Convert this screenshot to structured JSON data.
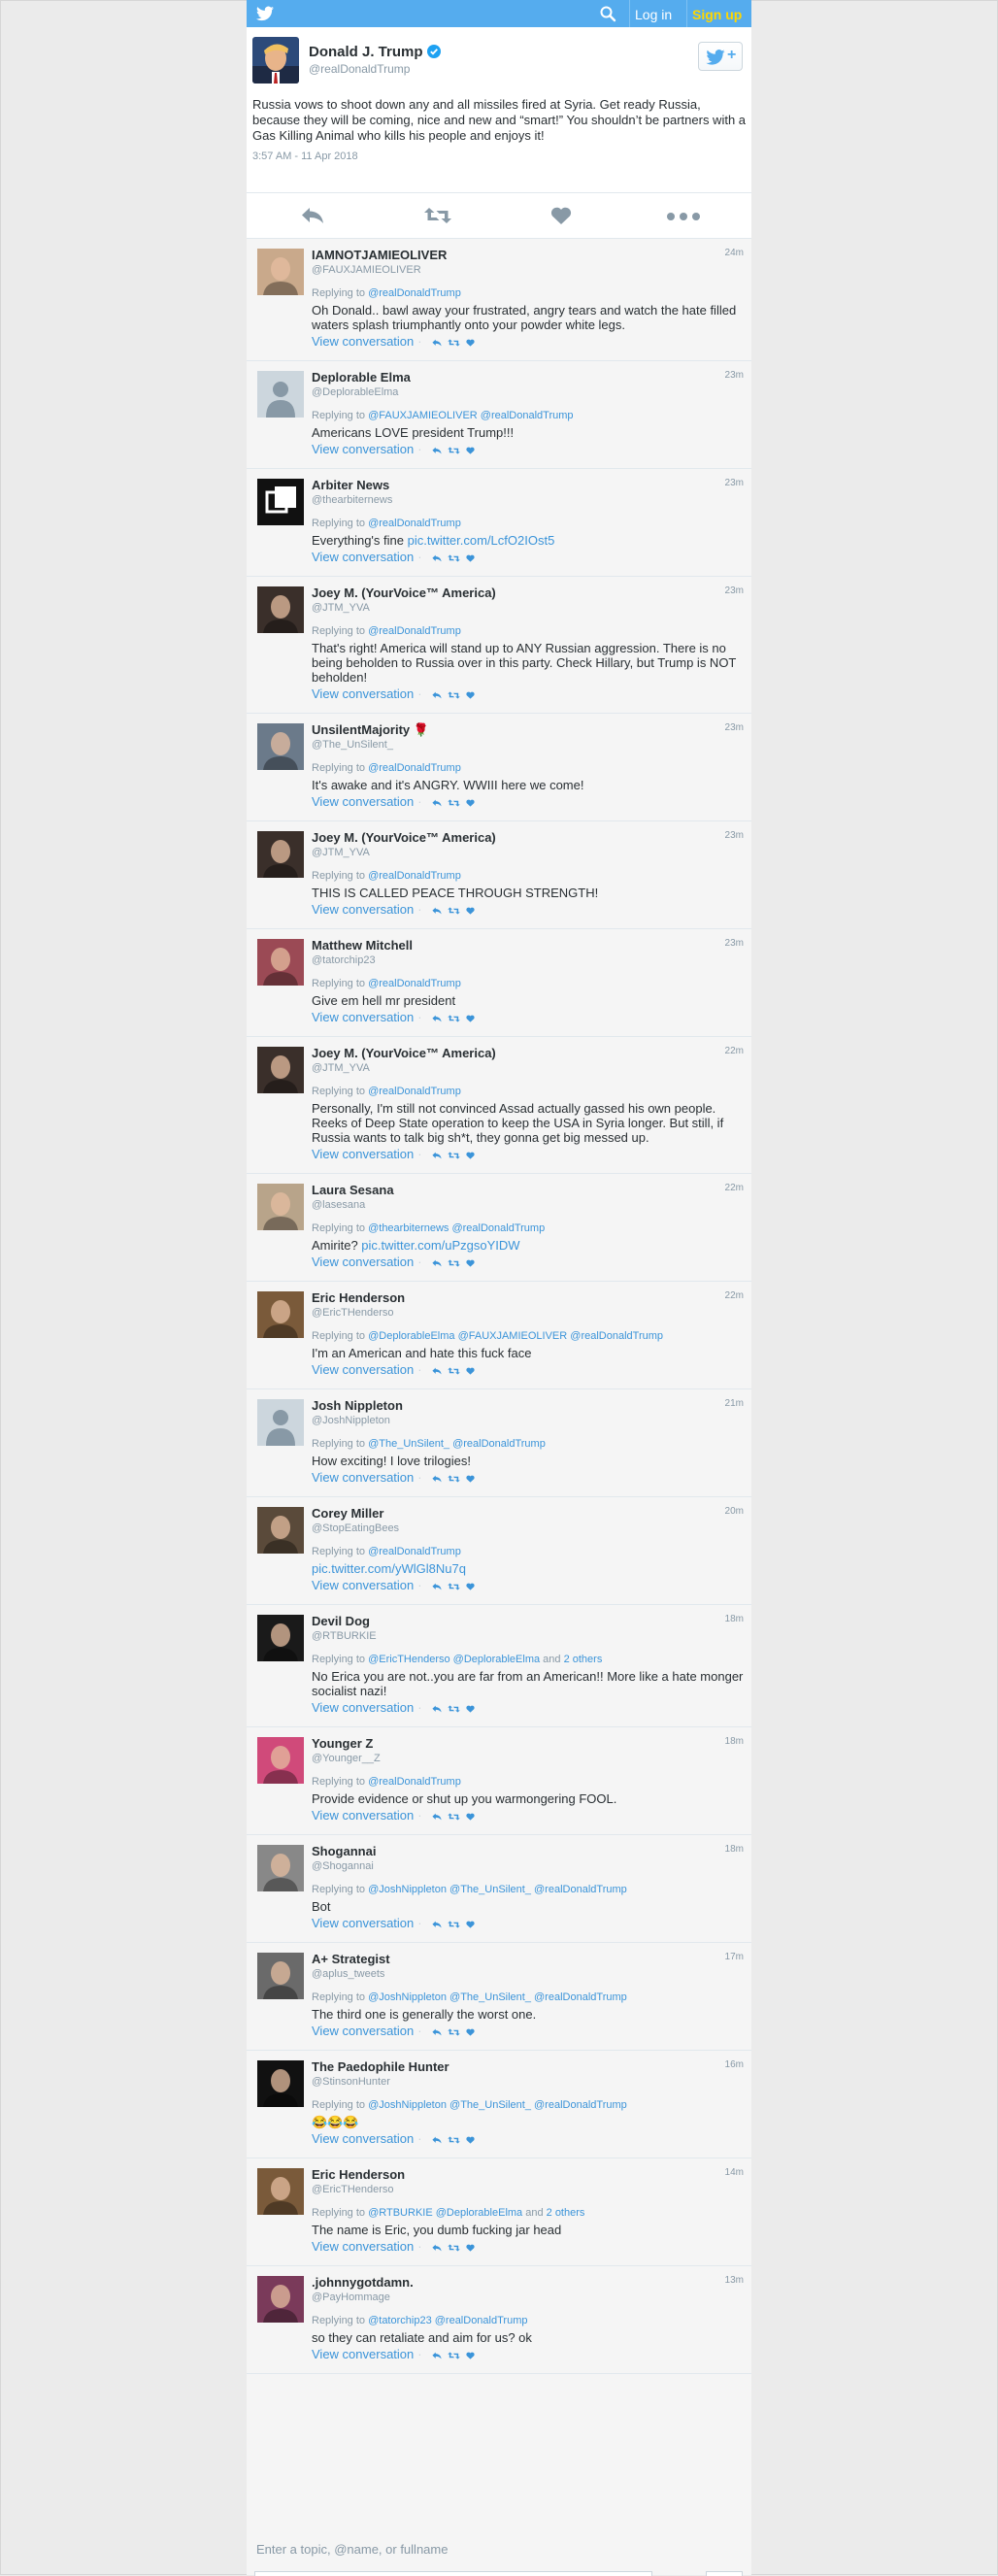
{
  "topbar": {
    "login": "Log in",
    "signup": "Sign up",
    "brand_color": "#55acee",
    "signup_color": "#ffd700"
  },
  "main_tweet": {
    "name": "Donald J. Trump",
    "handle": "@realDonaldTrump",
    "text": "Russia vows to shoot down any and all missiles fired at Syria. Get ready Russia, because they will be coming, nice and new and “smart!” You shouldn’t be partners with a Gas Killing Animal who kills his people and enjoys it!",
    "timestamp": "3:57 AM - 11 Apr 2018",
    "follow_label": "+"
  },
  "replies": [
    {
      "name": "IAMNOTJAMIEOLIVER",
      "handle": "@FAUXJAMIEOLIVER",
      "time": "24m",
      "replying_prefix": "Replying to ",
      "mentions": "@realDonaldTrump",
      "others": "",
      "text": "Oh Donald.. bawl away your frustrated, angry tears and watch the hate filled waters splash triumphantly onto your powder white legs.",
      "link": "",
      "avatar_color": "#c9a98b"
    },
    {
      "name": "Deplorable Elma",
      "handle": "@DeplorableElma",
      "time": "23m",
      "replying_prefix": "Replying to ",
      "mentions": "@FAUXJAMIEOLIVER @realDonaldTrump",
      "others": "",
      "text": "Americans LOVE president Trump!!!",
      "link": "",
      "avatar_color": "#ccd6dd"
    },
    {
      "name": "Arbiter News",
      "handle": "@thearbiternews",
      "time": "23m",
      "replying_prefix": "Replying to ",
      "mentions": "@realDonaldTrump",
      "others": "",
      "text": "Everything's fine ",
      "link": "pic.twitter.com/LcfO2IOst5",
      "avatar_color": "#111111"
    },
    {
      "name": "Joey M. (YourVoice™ America)",
      "handle": "@JTM_YVA",
      "time": "23m",
      "replying_prefix": "Replying to ",
      "mentions": "@realDonaldTrump",
      "others": "",
      "text": "That's right! America will stand up to ANY Russian aggression. There is no being beholden to Russia over in this party. Check Hillary, but Trump is NOT beholden!",
      "link": "",
      "avatar_color": "#3a2f2a"
    },
    {
      "name": "UnsilentMajority 🌹",
      "handle": "@The_UnSilent_",
      "time": "23m",
      "replying_prefix": "Replying to ",
      "mentions": "@realDonaldTrump",
      "others": "",
      "text": "It's awake and it's ANGRY. WWIII here we come!",
      "link": "",
      "avatar_color": "#6b7a8a"
    },
    {
      "name": "Joey M. (YourVoice™ America)",
      "handle": "@JTM_YVA",
      "time": "23m",
      "replying_prefix": "Replying to ",
      "mentions": "@realDonaldTrump",
      "others": "",
      "text": "THIS IS CALLED PEACE THROUGH STRENGTH!",
      "link": "",
      "avatar_color": "#3a2f2a"
    },
    {
      "name": "Matthew Mitchell",
      "handle": "@tatorchip23",
      "time": "23m",
      "replying_prefix": "Replying to ",
      "mentions": "@realDonaldTrump",
      "others": "",
      "text": "Give em hell mr president",
      "link": "",
      "avatar_color": "#9b4a55"
    },
    {
      "name": "Joey M. (YourVoice™ America)",
      "handle": "@JTM_YVA",
      "time": "22m",
      "replying_prefix": "Replying to ",
      "mentions": "@realDonaldTrump",
      "others": "",
      "text": "Personally, I'm still not convinced Assad actually gassed his own people. Reeks of Deep State operation to keep the USA in Syria longer. But still, if Russia wants to talk big sh*t, they gonna get big messed up.",
      "link": "",
      "avatar_color": "#3a2f2a"
    },
    {
      "name": "Laura Sesana",
      "handle": "@lasesana",
      "time": "22m",
      "replying_prefix": "Replying to ",
      "mentions": "@thearbiternews @realDonaldTrump",
      "others": "",
      "text": "Amirite? ",
      "link": "pic.twitter.com/uPzgsoYIDW",
      "avatar_color": "#b8a48a"
    },
    {
      "name": "Eric Henderson",
      "handle": "@EricTHenderso",
      "time": "22m",
      "replying_prefix": "Replying to ",
      "mentions": "@DeplorableElma @FAUXJAMIEOLIVER @realDonaldTrump",
      "others": "",
      "text": "I'm an American and hate this fuck face",
      "link": "",
      "avatar_color": "#7a5a3a"
    },
    {
      "name": "Josh Nippleton",
      "handle": "@JoshNippleton",
      "time": "21m",
      "replying_prefix": "Replying to ",
      "mentions": "@The_UnSilent_ @realDonaldTrump",
      "others": "",
      "text": "How exciting! I love trilogies!",
      "link": "",
      "avatar_color": "#ccd6dd"
    },
    {
      "name": "Corey Miller",
      "handle": "@StopEatingBees",
      "time": "20m",
      "replying_prefix": "Replying to ",
      "mentions": "@realDonaldTrump",
      "others": "",
      "text": "",
      "link": "pic.twitter.com/yWlGl8Nu7q",
      "avatar_color": "#5a4a3a"
    },
    {
      "name": "Devil Dog",
      "handle": "@RTBURKIE",
      "time": "18m",
      "replying_prefix": "Replying to ",
      "mentions": "@EricTHenderso @DeplorableElma",
      "others": "2 others",
      "text": "No Erica you are not..you are far from an American!! More like a hate monger socialist nazi!",
      "link": "",
      "avatar_color": "#1a1a1a"
    },
    {
      "name": "Younger Z",
      "handle": "@Younger__Z",
      "time": "18m",
      "replying_prefix": "Replying to ",
      "mentions": "@realDonaldTrump",
      "others": "",
      "text": "Provide evidence or shut up you warmongering FOOL.",
      "link": "",
      "avatar_color": "#d04a7a"
    },
    {
      "name": "Shogannai",
      "handle": "@Shogannai",
      "time": "18m",
      "replying_prefix": "Replying to ",
      "mentions": "@JoshNippleton @The_UnSilent_ @realDonaldTrump",
      "others": "",
      "text": "Bot",
      "link": "",
      "avatar_color": "#888888"
    },
    {
      "name": "A+ Strategist",
      "handle": "@aplus_tweets",
      "time": "17m",
      "replying_prefix": "Replying to ",
      "mentions": "@JoshNippleton @The_UnSilent_ @realDonaldTrump",
      "others": "",
      "text": "The third one is generally the worst one.",
      "link": "",
      "avatar_color": "#6a6a6a"
    },
    {
      "name": "The Paedophile Hunter",
      "handle": "@StinsonHunter",
      "time": "16m",
      "replying_prefix": "Replying to ",
      "mentions": "@JoshNippleton @The_UnSilent_ @realDonaldTrump",
      "others": "",
      "text": "😂😂😂",
      "link": "",
      "avatar_color": "#111111"
    },
    {
      "name": "Eric Henderson",
      "handle": "@EricTHenderso",
      "time": "14m",
      "replying_prefix": "Replying to ",
      "mentions": "@RTBURKIE @DeplorableElma",
      "others": "2 others",
      "text": "The name is Eric, you dumb fucking jar head",
      "link": "",
      "avatar_color": "#7a5a3a"
    },
    {
      "name": ".johnnygotdamn.",
      "handle": "@PayHommage",
      "time": "13m",
      "replying_prefix": "Replying to ",
      "mentions": "@tatorchip23 @realDonaldTrump",
      "others": "",
      "text": "so they can retaliate and aim for us? ok",
      "link": "",
      "avatar_color": "#7a3a5a"
    }
  ],
  "view_conversation": "View conversation",
  "and_word": " and ",
  "search_placeholder": "Enter a topic, @name, or fullname"
}
